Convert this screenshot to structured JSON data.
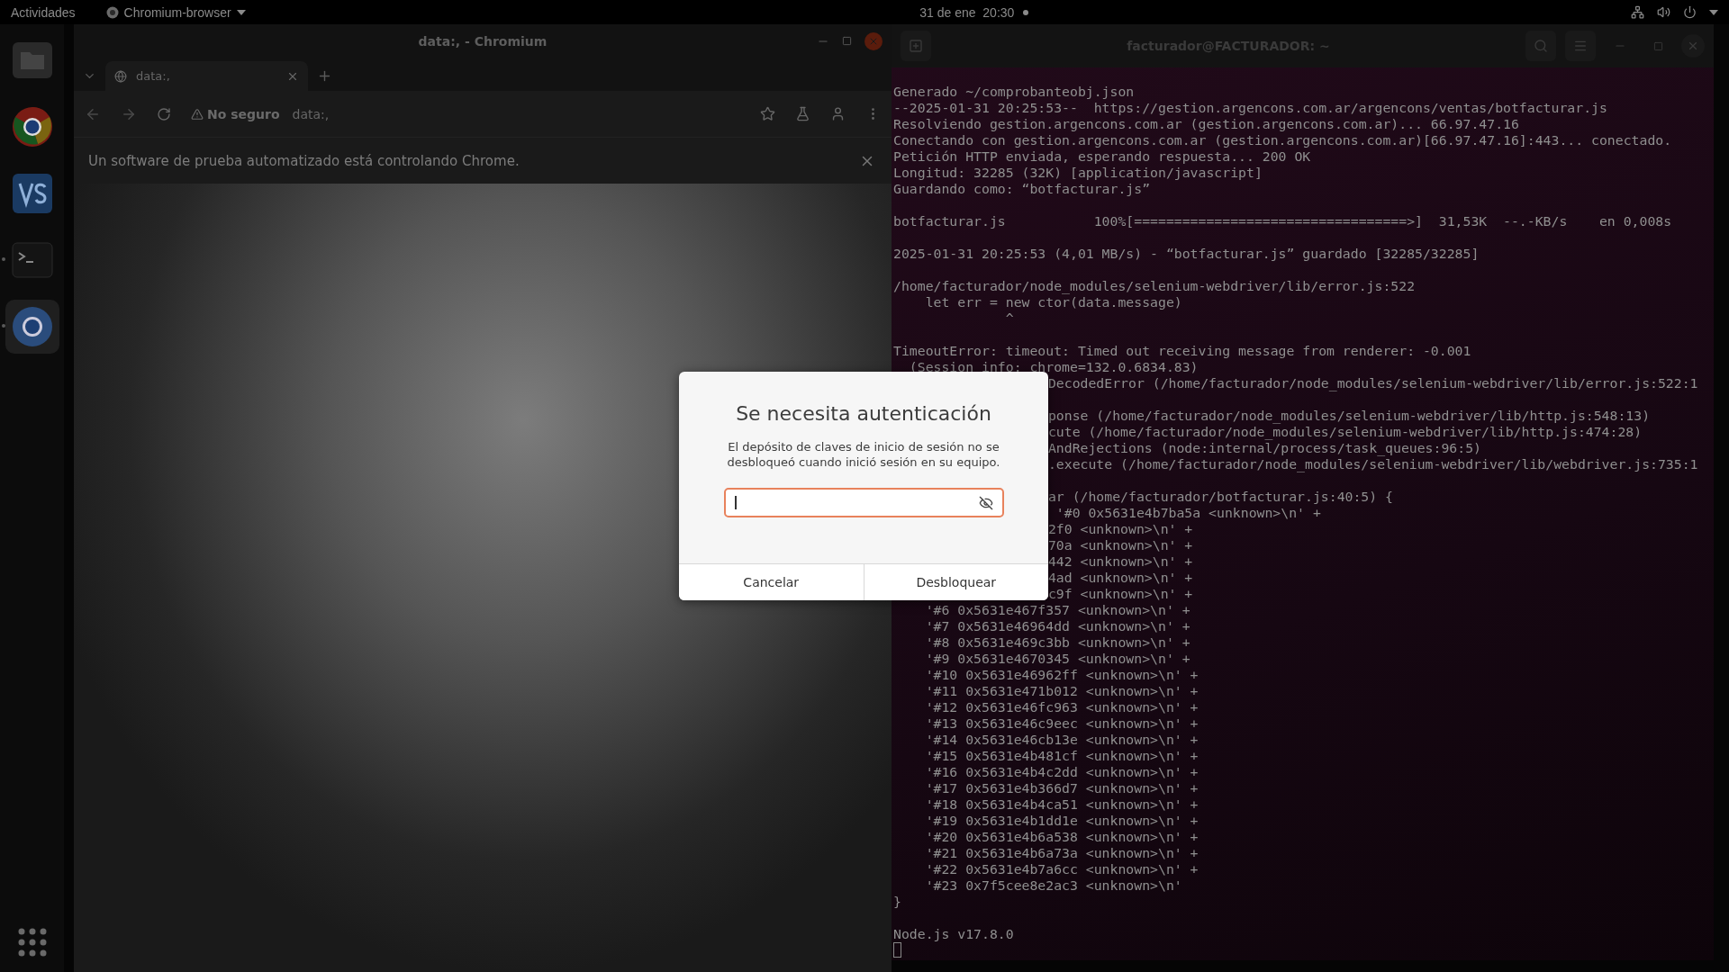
{
  "top_bar": {
    "activities": "Actividades",
    "app_menu": "Chromium-browser",
    "clock": "31 de ene  20:30"
  },
  "dock": [
    {
      "kind": "files",
      "running": false,
      "selected": false
    },
    {
      "kind": "chrome",
      "running": false,
      "selected": false
    },
    {
      "kind": "editor",
      "running": false,
      "selected": false
    },
    {
      "kind": "terminal",
      "running": true,
      "selected": false
    },
    {
      "kind": "chromium",
      "running": true,
      "selected": true
    }
  ],
  "browser": {
    "title": "data:, - Chromium",
    "tab": "data:,",
    "security": "No seguro",
    "url": "data:,",
    "infobar": "Un software de prueba automatizado está controlando Chrome."
  },
  "terminal": {
    "title": "facturador@FACTURADOR: ~",
    "lines": [
      {
        "kind": "full",
        "text": "Generado ~/comprobanteobj.json"
      },
      {
        "kind": "full",
        "text": "--2025-01-31 20:25:53--  https://gestion.argencons.com.ar/argencons/ventas/botfacturar.js"
      },
      {
        "kind": "full",
        "text": "Resolviendo gestion.argencons.com.ar (gestion.argencons.com.ar)... 66.97.47.16"
      },
      {
        "kind": "full",
        "text": "Conectando con gestion.argencons.com.ar (gestion.argencons.com.ar)[66.97.47.16]:443... conectado."
      },
      {
        "kind": "full",
        "text": "Petición HTTP enviada, esperando respuesta... 200 OK"
      },
      {
        "kind": "full",
        "text": "Longitud: 32285 (32K) [application/javascript]"
      },
      {
        "kind": "full",
        "text": "Guardando como: “botfacturar.js”"
      },
      {
        "kind": "blank"
      },
      {
        "kind": "full",
        "text": "botfacturar.js           100%[==================================>]  31,53K  --.-KB/s    en 0,008s"
      },
      {
        "kind": "blank"
      },
      {
        "kind": "full",
        "text": "2025-01-31 20:25:53 (4,01 MB/s) - “botfacturar.js” guardado [32285/32285]"
      },
      {
        "kind": "blank"
      },
      {
        "kind": "full",
        "text": "/home/facturador/node_modules/selenium-webdriver/lib/error.js:522"
      },
      {
        "kind": "full",
        "text": "    let err = new ctor(data.message)"
      },
      {
        "kind": "full",
        "text": "              ^"
      },
      {
        "kind": "blank"
      },
      {
        "kind": "full",
        "text": "TimeoutError: timeout: Timed out receiving message from renderer: -0.001"
      },
      {
        "kind": "full",
        "text": "  (Session info: chrome=132.0.6834.83)"
      },
      {
        "kind": "partial",
        "text": "DecodedError (/home/facturador/node_modules/selenium-webdriver/lib/error.js:522:1"
      },
      {
        "kind": "blank"
      },
      {
        "kind": "partial",
        "text": "ponse (/home/facturador/node_modules/selenium-webdriver/lib/http.js:548:13)"
      },
      {
        "kind": "partial",
        "text": "cute (/home/facturador/node_modules/selenium-webdriver/lib/http.js:474:28)"
      },
      {
        "kind": "partial",
        "text": "AndRejections (node:internal/process/task_queues:96:5)"
      },
      {
        "kind": "partial",
        "text": ".execute (/home/facturador/node_modules/selenium-webdriver/lib/webdriver.js:735:1"
      },
      {
        "kind": "blank"
      },
      {
        "kind": "partial",
        "text": "ar (/home/facturador/botfacturar.js:40:5) {"
      },
      {
        "kind": "partial",
        "text": " '#0 0x5631e4b7ba5a <unknown>\\n' +"
      },
      {
        "kind": "partial",
        "text": "2f0 <unknown>\\n' +"
      },
      {
        "kind": "partial",
        "text": "70a <unknown>\\n' +"
      },
      {
        "kind": "partial",
        "text": "442 <unknown>\\n' +"
      },
      {
        "kind": "partial",
        "text": "4ad <unknown>\\n' +"
      },
      {
        "kind": "partial",
        "text": "c9f <unknown>\\n' +"
      },
      {
        "kind": "full",
        "text": "    '#6 0x5631e467f357 <unknown>\\n' +"
      },
      {
        "kind": "full",
        "text": "    '#7 0x5631e46964dd <unknown>\\n' +"
      },
      {
        "kind": "full",
        "text": "    '#8 0x5631e469c3bb <unknown>\\n' +"
      },
      {
        "kind": "full",
        "text": "    '#9 0x5631e4670345 <unknown>\\n' +"
      },
      {
        "kind": "full",
        "text": "    '#10 0x5631e46962ff <unknown>\\n' +"
      },
      {
        "kind": "full",
        "text": "    '#11 0x5631e471b012 <unknown>\\n' +"
      },
      {
        "kind": "full",
        "text": "    '#12 0x5631e46fc963 <unknown>\\n' +"
      },
      {
        "kind": "full",
        "text": "    '#13 0x5631e46c9eec <unknown>\\n' +"
      },
      {
        "kind": "full",
        "text": "    '#14 0x5631e46cb13e <unknown>\\n' +"
      },
      {
        "kind": "full",
        "text": "    '#15 0x5631e4b481cf <unknown>\\n' +"
      },
      {
        "kind": "full",
        "text": "    '#16 0x5631e4b4c2dd <unknown>\\n' +"
      },
      {
        "kind": "full",
        "text": "    '#17 0x5631e4b366d7 <unknown>\\n' +"
      },
      {
        "kind": "full",
        "text": "    '#18 0x5631e4b4ca51 <unknown>\\n' +"
      },
      {
        "kind": "full",
        "text": "    '#19 0x5631e4b1dd1e <unknown>\\n' +"
      },
      {
        "kind": "full",
        "text": "    '#20 0x5631e4b6a538 <unknown>\\n' +"
      },
      {
        "kind": "full",
        "text": "    '#21 0x5631e4b6a73a <unknown>\\n' +"
      },
      {
        "kind": "full",
        "text": "    '#22 0x5631e4b7a6cc <unknown>\\n' +"
      },
      {
        "kind": "full",
        "text": "    '#23 0x7f5cee8e2ac3 <unknown>\\n'"
      },
      {
        "kind": "full",
        "text": "}"
      },
      {
        "kind": "blank"
      },
      {
        "kind": "full",
        "text": "Node.js v17.8.0"
      }
    ]
  },
  "dialog": {
    "title": "Se necesita autenticación",
    "message": "El depósito de claves de inicio de sesión no se desbloqueó cuando inició sesión en su equipo.",
    "buttons": [
      "Cancelar",
      "Desbloquear"
    ]
  }
}
